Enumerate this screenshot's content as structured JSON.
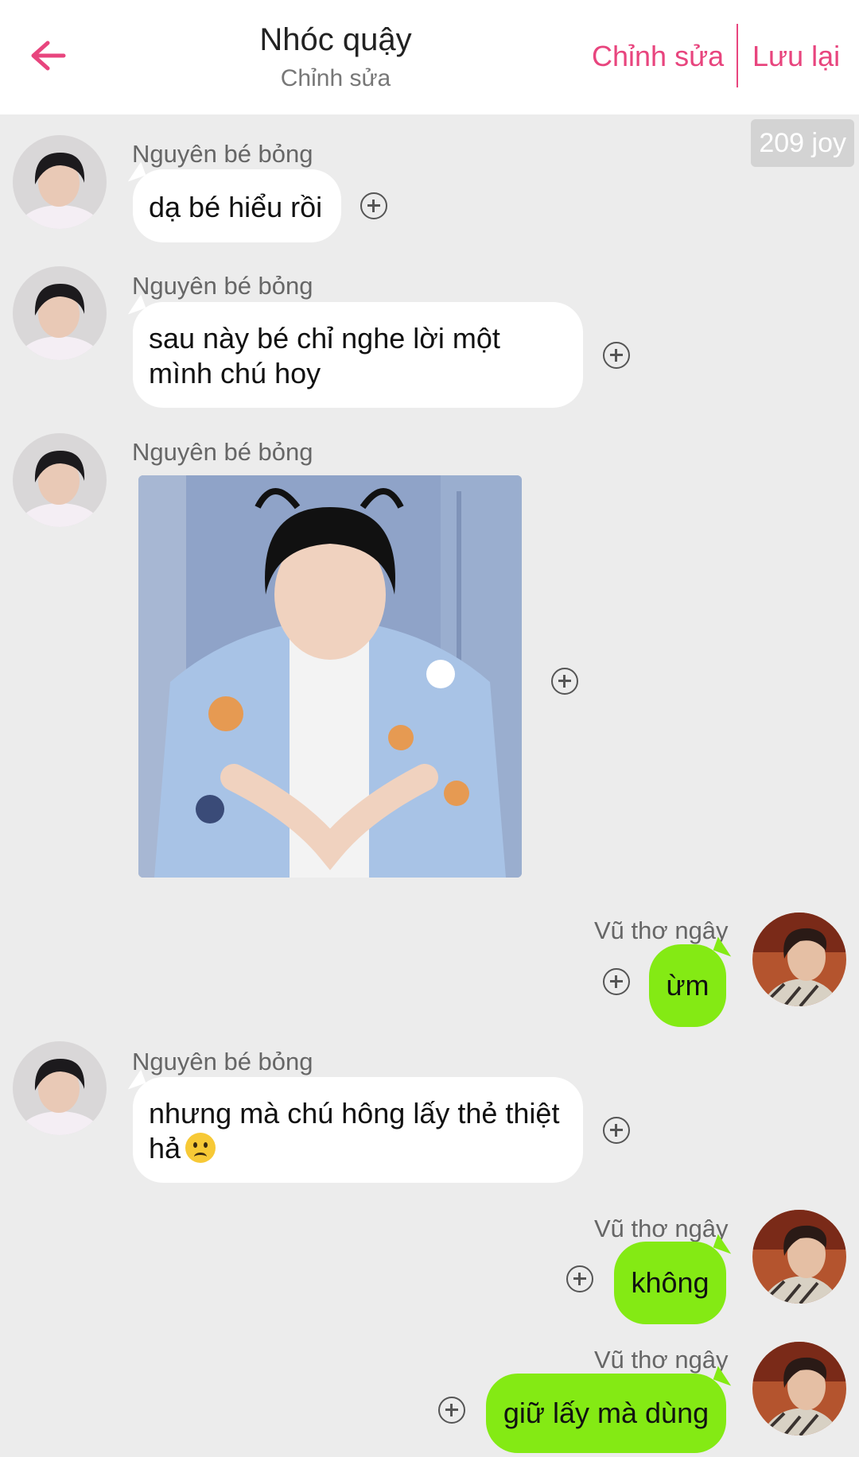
{
  "header": {
    "title": "Nhóc quậy",
    "subtitle": "Chỉnh sửa",
    "edit_label": "Chỉnh sửa",
    "save_label": "Lưu lại",
    "accent_color": "#e8457e"
  },
  "joy_badge": "209 joy",
  "messages": [
    {
      "sender": "Nguyên bé bỏng",
      "side": "left",
      "text": "dạ bé hiểu rồi"
    },
    {
      "sender": "Nguyên bé bỏng",
      "side": "left",
      "text_line1": "sau này bé chỉ nghe lời một",
      "text_line2": "mình chú hoy"
    },
    {
      "sender": "Nguyên bé bỏng",
      "side": "left",
      "type": "image"
    },
    {
      "sender": "Vũ thơ ngây",
      "side": "right",
      "text": "ừm"
    },
    {
      "sender": "Nguyên bé bỏng",
      "side": "left",
      "text_line1": "nhưng mà chú hông lấy thẻ thiệt",
      "text_line2": "hả",
      "emoji": "slightly-frowning-face"
    },
    {
      "sender": "Vũ thơ ngây",
      "side": "right",
      "text": "không"
    },
    {
      "sender": "Vũ thơ ngây",
      "side": "right",
      "text": "giữ lấy mà dùng"
    }
  ],
  "colors": {
    "right_bubble": "#84ea14",
    "left_bubble": "#ffffff",
    "background": "#ececec"
  }
}
